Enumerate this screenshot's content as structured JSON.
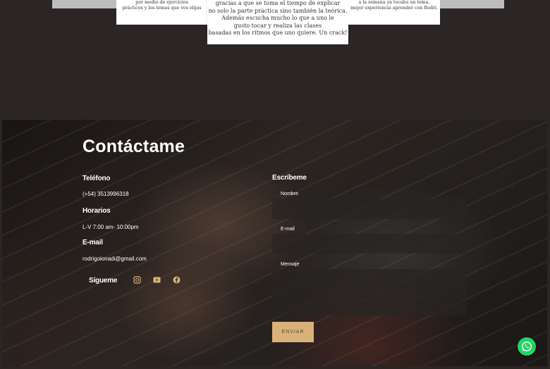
{
  "testimonials": {
    "left_lines": [
      "por medio de ejercicios",
      "prácticos y los temas que vos elijas"
    ],
    "mid_lines": [
      "gracias a que se toma el tiempo de explicar",
      "no solo la parte práctica sino también la teórica.",
      "Además escucha mucho lo que a uno le",
      "gusto tocar y realiza las clases",
      "basadas en los ritmos que uno quiere. Un crack!"
    ],
    "right_lines": [
      "a la semana ya tocaba un tema.",
      "mejor experiencia aprender con Rodri."
    ]
  },
  "contact": {
    "title": "Contáctame",
    "phone_label": "Teléfono",
    "phone_value": "(+54) 3513996318",
    "hours_label": "Horarios",
    "hours_value": "L-V 7:00 am- 10:00pm",
    "email_label": "E-mail",
    "email_value": "rodrigoionadi@gmail.com",
    "follow_label": "Sígueme",
    "social_icons": [
      "instagram-icon",
      "youtube-icon",
      "facebook-icon"
    ],
    "accent_color": "#d9b27a"
  },
  "form": {
    "heading": "Escríbeme",
    "name_label": "Nombre",
    "name_value": "",
    "email_label": "E-mail",
    "email_value": "",
    "message_label": "Mensaje",
    "message_value": "",
    "submit_label": "ENVIAR"
  },
  "whatsapp": {
    "icon": "whatsapp-icon",
    "color": "#25d366"
  }
}
